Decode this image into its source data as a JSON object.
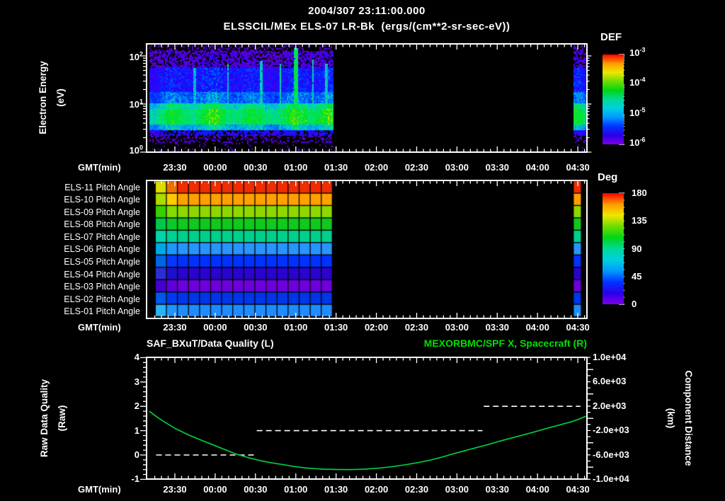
{
  "colors": {
    "background": "#000000",
    "foreground": "#ffffff",
    "right_title_green": "#00e100",
    "curve_green": "#00cd3f",
    "colorbar_gradient": [
      "#ff0000",
      "#ff9b00",
      "#efe600",
      "#6edd00",
      "#00d514",
      "#00d998",
      "#00cfe0",
      "#0099ff",
      "#0033ff",
      "#2a00e8",
      "#7c00e8"
    ]
  },
  "title": {
    "date_line": "2004/307 23:11:00.000",
    "instrument_line": "ELSSCIL/MEx ELS-07 LR-Bk  (ergs/(cm**2-sr-sec-eV))"
  },
  "time_axis": {
    "label": "GMT(min)",
    "tick_labels": [
      "23:30",
      "00:00",
      "00:30",
      "01:00",
      "01:30",
      "02:00",
      "02:30",
      "03:00",
      "03:30",
      "04:00",
      "04:30"
    ],
    "tick_minutes_after_start": [
      19,
      49,
      79,
      109,
      139,
      169,
      199,
      229,
      259,
      289,
      319
    ],
    "minor_step_min": 5,
    "start_time": "23:11"
  },
  "spectrogram_panel": {
    "ylabel": [
      "Electron Energy",
      "(eV)"
    ],
    "ytick_labels": [
      "10^2",
      "10^1",
      "10^0"
    ],
    "colorbar": {
      "title": "DEF",
      "tick_labels": [
        "10^-3",
        "10^-4",
        "10^-5",
        "10^-6"
      ]
    }
  },
  "pitch_panel": {
    "row_labels": [
      "ELS-11 Pitch Angle",
      "ELS-10 Pitch Angle",
      "ELS-09 Pitch Angle",
      "ELS-08 Pitch Angle",
      "ELS-07 Pitch Angle",
      "ELS-06 Pitch Angle",
      "ELS-05 Pitch Angle",
      "ELS-04 Pitch Angle",
      "ELS-03 Pitch Angle",
      "ELS-02 Pitch Angle",
      "ELS-01 Pitch Angle"
    ],
    "colorbar": {
      "title": "Deg",
      "tick_labels": [
        "180",
        "135",
        "90",
        "45",
        "0"
      ]
    }
  },
  "line_panel": {
    "title_left": "SAF_BXuT/Data Quality (L)",
    "title_right": "MEXORBMC/SPF X, Spacecraft (R)",
    "ylabel_left": [
      "Raw Data Quality",
      "(Raw)"
    ],
    "ytick_left": [
      "4",
      "3",
      "2",
      "1",
      "0",
      "-1"
    ],
    "ylabel_right": [
      "Component Distance",
      "(km)"
    ],
    "ytick_right": [
      "1.0e+04",
      "6.0e+03",
      "2.0e+03",
      "-2.0e+03",
      "-6.0e+03",
      "-1.0e+04"
    ]
  },
  "chart_data": [
    {
      "type": "heatmap",
      "name": "electron-energy-spectrogram",
      "title": "ELSSCIL/MEx ELS-07 LR-Bk",
      "z_units": "ergs/(cm**2-sr-sec-eV)",
      "z_scale": "log",
      "z_range": [
        "1e-6",
        "1e-3"
      ],
      "y_scale": "log",
      "y_range_ev": [
        1,
        178
      ],
      "time_coverage_min": [
        [
          0,
          137
        ],
        [
          316,
          325.5
        ]
      ],
      "time_coverage": [
        [
          "23:11",
          "01:28"
        ],
        [
          "04:27",
          "04:37"
        ]
      ],
      "bands": [
        {
          "ev": [
            127,
            178
          ],
          "v": 0.05,
          "p": 0.35,
          "n": 0.1,
          "note": "sparse violet speckle"
        },
        {
          "ev": [
            58,
            127
          ],
          "v": 0.1,
          "p": 0.75,
          "n": 0.12,
          "note": "violet/blue speckle ~1e-6"
        },
        {
          "ev": [
            18,
            58
          ],
          "v": 0.21,
          "p": 1.0,
          "n": 0.16,
          "note": "blue noisy ~1e-5"
        },
        {
          "ev": [
            11,
            18
          ],
          "v": 0.33,
          "p": 1.0,
          "n": 0.14,
          "note": "blue-cyan"
        },
        {
          "ev": [
            8,
            11
          ],
          "v": 0.5,
          "p": 1.0,
          "n": 0.12,
          "note": "cyan-green"
        },
        {
          "ev": [
            4,
            8
          ],
          "v": 0.58,
          "p": 1.0,
          "n": 0.12,
          "note": "bright green band ~1e-4"
        },
        {
          "ev": [
            2.9,
            4
          ],
          "v": 0.42,
          "p": 1.0,
          "n": 0.12,
          "note": "cyan lower edge"
        },
        {
          "ev": [
            2.2,
            2.9
          ],
          "v": 0.18,
          "p": 0.8,
          "n": 0.12,
          "note": "blue thin band"
        },
        {
          "ev": [
            1.6,
            2.2
          ],
          "v": 0.08,
          "p": 0.35,
          "n": 0.1,
          "note": "violet speckle"
        },
        {
          "ev": [
            1.0,
            1.6
          ],
          "v": 0.06,
          "p": 0.08,
          "n": 0.08,
          "note": "sparse dots"
        }
      ],
      "streaks_min": [
        {
          "t": 33,
          "v": 0.42,
          "w": 0.8,
          "emax": 60
        },
        {
          "t": 58,
          "v": 0.42,
          "w": 0.8,
          "emax": 70
        },
        {
          "t": 83,
          "v": 0.45,
          "w": 1.0,
          "emax": 80
        },
        {
          "t": 97,
          "v": 0.45,
          "w": 0.8,
          "emax": 70
        },
        {
          "t": 109,
          "v": 0.55,
          "w": 1.6,
          "emax": 150
        },
        {
          "t": 121,
          "v": 0.45,
          "w": 0.8,
          "emax": 90
        },
        {
          "t": 131,
          "v": 0.42,
          "w": 0.8,
          "emax": 70
        }
      ],
      "features": [
        "bright narrow enhancement near 01:00 reaching ~150 eV",
        "data gap 01:28-04:27"
      ]
    },
    {
      "type": "heatmap",
      "name": "pitch-angle-rows",
      "scale": {
        "title": "Deg",
        "range": [
          0,
          180
        ]
      },
      "time_coverage_min": [
        [
          4.7,
          137
        ],
        [
          316,
          321.5
        ]
      ],
      "time_coverage": [
        [
          "23:16",
          "01:28"
        ],
        [
          "04:27",
          "04:32"
        ]
      ],
      "n_cols": 16,
      "rows": [
        {
          "label": "ELS-11 Pitch Angle",
          "approx_deg": 170,
          "color": "#ee2e00",
          "first_cols": [
            "#dcdc00",
            "#f07000"
          ]
        },
        {
          "label": "ELS-10 Pitch Angle",
          "approx_deg": 148,
          "color": "#ffa000",
          "first_cols": [
            "#aadc00",
            "#ffcc00"
          ]
        },
        {
          "label": "ELS-09 Pitch Angle",
          "approx_deg": 125,
          "color": "#8cd800",
          "first_cols": [
            "#38d000",
            "#84dc00"
          ]
        },
        {
          "label": "ELS-08 Pitch Angle",
          "approx_deg": 110,
          "color": "#10c81e",
          "first_cols": [
            "#00c84a",
            "#0cc828"
          ]
        },
        {
          "label": "ELS-07 Pitch Angle",
          "approx_deg": 96,
          "color": "#00d08c",
          "first_cols": [
            "#00d4a8",
            "#00d094"
          ]
        },
        {
          "label": "ELS-06 Pitch Angle",
          "approx_deg": 72,
          "color": "#2894ff",
          "first_cols": [
            "#00a8e8",
            "#1e96ff"
          ]
        },
        {
          "label": "ELS-05 Pitch Angle",
          "approx_deg": 45,
          "color": "#0032ff",
          "first_cols": [
            "#0064e8",
            "#0038ff"
          ]
        },
        {
          "label": "ELS-04 Pitch Angle",
          "approx_deg": 27,
          "color": "#2804cc",
          "first_cols": [
            "#2e2ed0",
            "#1c10cc"
          ]
        },
        {
          "label": "ELS-03 Pitch Angle",
          "approx_deg": 14,
          "color": "#6e00dc",
          "first_cols": [
            "#4400cc",
            "#5f00d8"
          ]
        },
        {
          "label": "ELS-02 Pitch Angle",
          "approx_deg": 42,
          "color": "#0036e8",
          "first_cols": [
            "#0058e8",
            "#0038f0"
          ]
        },
        {
          "label": "ELS-01 Pitch Angle",
          "approx_deg": 64,
          "color": "#1e8cff",
          "first_cols": [
            "#28b4f8",
            "#1e96ff"
          ]
        }
      ]
    },
    {
      "type": "line",
      "name": "quality-and-spacecraft-x",
      "ylim_left": [
        -1,
        4
      ],
      "ylim_right": [
        -10000,
        10000
      ],
      "series": [
        {
          "name": "SAF_BXuT/Data Quality (L)",
          "axis": "left",
          "style": "white dashed steps",
          "points_min_value": [
            [
              5,
              0
            ],
            [
              79,
              0
            ],
            [
              80,
              1
            ],
            [
              248,
              1
            ],
            [
              249,
              2
            ],
            [
              321,
              2
            ]
          ]
        },
        {
          "name": "MEXORBMC/SPF X, Spacecraft (R)",
          "axis": "right",
          "style": "green solid",
          "points_min_km": [
            [
              0,
              1160
            ],
            [
              6,
              160
            ],
            [
              12,
              -700
            ],
            [
              20,
              -1750
            ],
            [
              30,
              -2800
            ],
            [
              40,
              -3700
            ],
            [
              47,
              -4300
            ],
            [
              56,
              -5100
            ],
            [
              64,
              -5800
            ],
            [
              73,
              -6400
            ],
            [
              82,
              -6900
            ],
            [
              91,
              -7300
            ],
            [
              100,
              -7600
            ],
            [
              108,
              -7900
            ],
            [
              115,
              -8100
            ],
            [
              123,
              -8250
            ],
            [
              131,
              -8340
            ],
            [
              140,
              -8390
            ],
            [
              150,
              -8400
            ],
            [
              160,
              -8330
            ],
            [
              170,
              -8180
            ],
            [
              180,
              -7950
            ],
            [
              191,
              -7600
            ],
            [
              200,
              -7250
            ],
            [
              210,
              -6800
            ],
            [
              218,
              -6350
            ],
            [
              226,
              -5820
            ],
            [
              235,
              -5290
            ],
            [
              244,
              -4770
            ],
            [
              252,
              -4300
            ],
            [
              261,
              -3720
            ],
            [
              270,
              -3200
            ],
            [
              279,
              -2680
            ],
            [
              288,
              -2150
            ],
            [
              296,
              -1630
            ],
            [
              305,
              -1100
            ],
            [
              314,
              -580
            ],
            [
              320,
              -120
            ],
            [
              325,
              350
            ]
          ]
        }
      ]
    }
  ]
}
